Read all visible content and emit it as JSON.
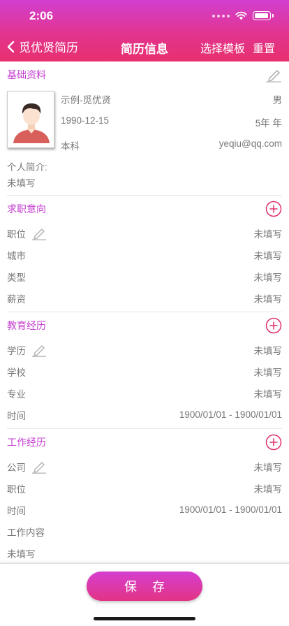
{
  "status_bar": {
    "time": "2:06"
  },
  "nav": {
    "back_label": "觅优贤简历",
    "title": "简历信息",
    "template_label": "选择模板",
    "reset_label": "重置"
  },
  "basic": {
    "title": "基础资料",
    "name": "示例-觅优贤",
    "gender": "男",
    "birth": "1990-12-15",
    "experience": "5年 年",
    "education": "本科",
    "email": "yeqiu@qq.com",
    "intro_label": "个人简介:",
    "intro_value": "未填写"
  },
  "intent": {
    "title": "求职意向",
    "rows": [
      {
        "label": "职位",
        "value": "未填写"
      },
      {
        "label": "城市",
        "value": "未填写"
      },
      {
        "label": "类型",
        "value": "未填写"
      },
      {
        "label": "薪资",
        "value": "未填写"
      }
    ]
  },
  "education": {
    "title": "教育经历",
    "rows": [
      {
        "label": "学历",
        "value": "未填写"
      },
      {
        "label": "学校",
        "value": "未填写"
      },
      {
        "label": "专业",
        "value": "未填写"
      },
      {
        "label": "时间",
        "value": "1900/01/01 - 1900/01/01"
      }
    ]
  },
  "work": {
    "title": "工作经历",
    "rows": [
      {
        "label": "公司",
        "value": "未填写"
      },
      {
        "label": "职位",
        "value": "未填写"
      },
      {
        "label": "时间",
        "value": "1900/01/01 - 1900/01/01"
      }
    ],
    "content_label": "工作内容",
    "content_value": "未填写"
  },
  "footer": {
    "save_label": "保存"
  },
  "colors": {
    "accent": "#c53fd0",
    "plus": "#e0306a",
    "gradient_start": "#d23fd0",
    "gradient_end": "#e8306e"
  }
}
